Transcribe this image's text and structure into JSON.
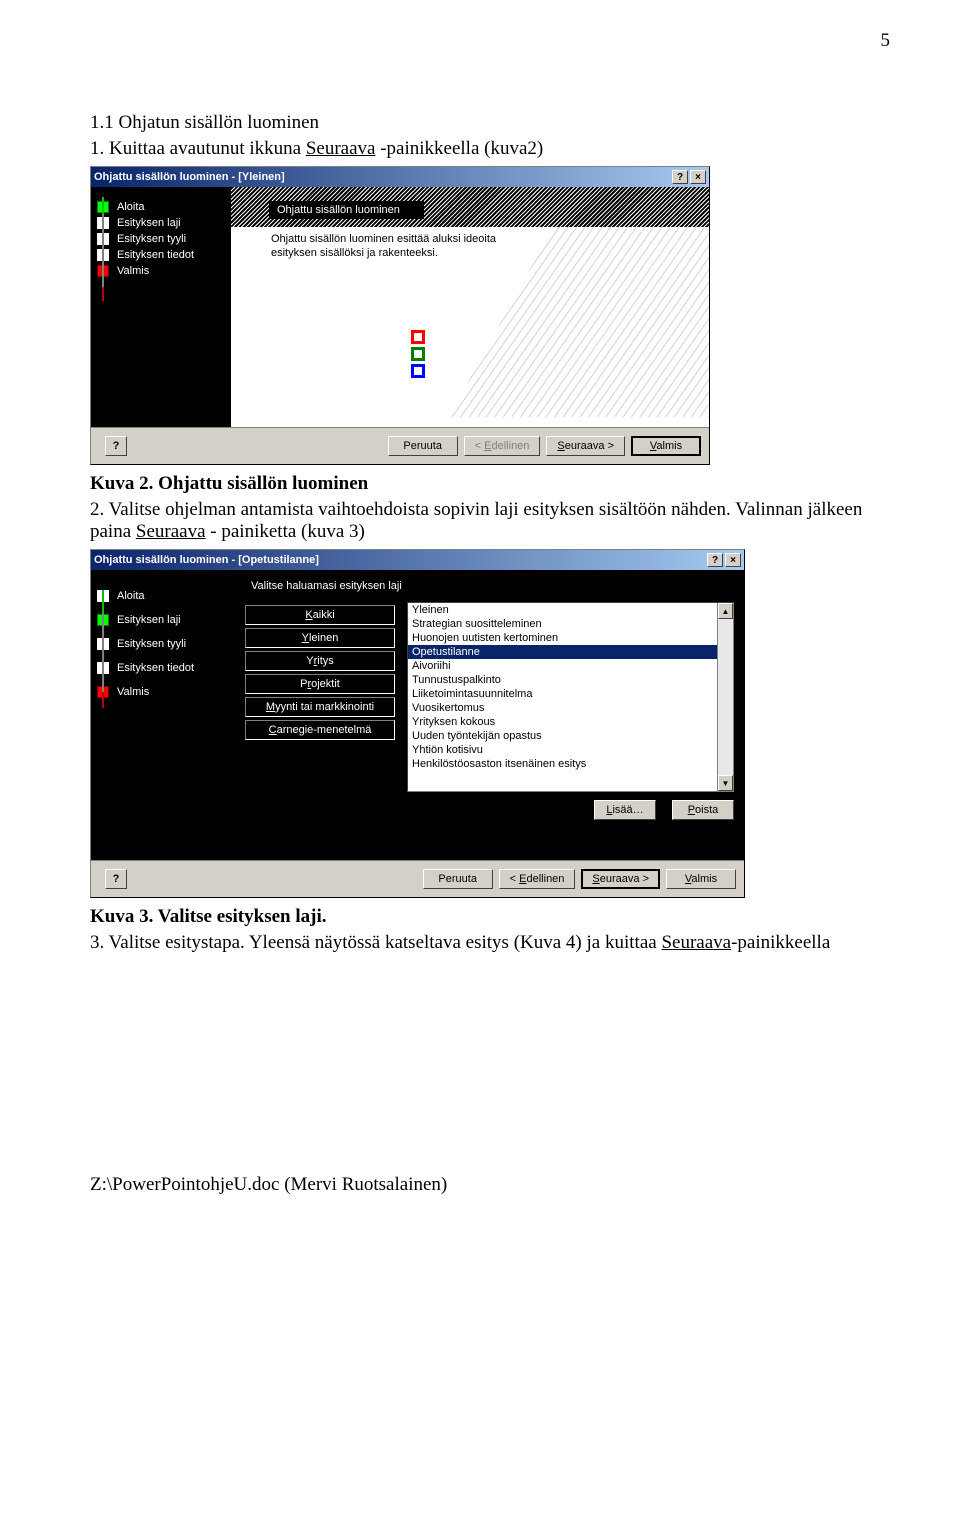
{
  "page_number": "5",
  "heading": "1.1 Ohjatun sisällön luominen",
  "para1_pre": "1. Kuittaa avautunut ikkuna ",
  "para1_link": "Seuraava",
  "para1_post": " -painikkeella (kuva2)",
  "caption1": "Kuva 2. Ohjattu sisällön luominen",
  "para2_pre": "2. Valitse ohjelman antamista vaihtoehdoista sopivin laji esityksen sisältöön nähden. Valinnan jälkeen paina ",
  "para2_link": "Seuraava",
  "para2_post": " - painiketta (kuva 3)",
  "caption2": "Kuva 3. Valitse esityksen laji.",
  "para3_pre": "3. Valitse esitystapa. Yleensä näytössä katseltava esitys (Kuva 4) ja kuittaa ",
  "para3_link": "Seuraava",
  "para3_post": "-painikkeella",
  "footer": "Z:\\PowerPointohjeU.doc (Mervi Ruotsalainen)",
  "dialog1": {
    "title": "Ohjattu sisällön luominen - [Yleinen]",
    "help_btn": "?",
    "close_btn": "×",
    "steps": [
      "Aloita",
      "Esityksen laji",
      "Esityksen tyyli",
      "Esityksen tiedot",
      "Valmis"
    ],
    "box_title": "Ohjattu sisällön luominen",
    "description": "Ohjattu sisällön luominen esittää aluksi ideoita esityksen sisällöksi ja rakenteeksi.",
    "buttons": {
      "help": "?",
      "cancel": "Peruuta",
      "back_pre": "< ",
      "back_u": "E",
      "back_post": "dellinen",
      "next_u": "S",
      "next_post": "euraava >",
      "finish_u": "V",
      "finish_post": "almis"
    }
  },
  "dialog2": {
    "title": "Ohjattu sisällön luominen - [Opetustilanne]",
    "help_btn": "?",
    "close_btn": "×",
    "steps": [
      "Aloita",
      "Esityksen laji",
      "Esityksen tyyli",
      "Esityksen tiedot",
      "Valmis"
    ],
    "prompt": "Valitse haluamasi esityksen laji",
    "categories": [
      {
        "u": "K",
        "post": "aikki"
      },
      {
        "u": "Y",
        "post": "leinen"
      },
      {
        "pre": "Y",
        "u": "r",
        "post": "itys"
      },
      {
        "pre": "P",
        "u": "r",
        "post": "ojektit"
      },
      {
        "u": "M",
        "post": "yynti tai markkinointi"
      },
      {
        "u": "C",
        "post": "arnegie-menetelmä"
      }
    ],
    "list": [
      "Yleinen",
      "Strategian suositteleminen",
      "Huonojen uutisten kertominen",
      "Opetustilanne",
      "Aivoriihi",
      "Tunnustuspalkinto",
      "Liiketoimintasuunnitelma",
      "Vuosikertomus",
      "Yrityksen kokous",
      "Uuden työntekijän opastus",
      "Yhtiön kotisivu",
      "Henkilöstöosaston itsenäinen esitys"
    ],
    "selected_index": 3,
    "add_u": "L",
    "add_post": "isää…",
    "del_u": "P",
    "del_post": "oista",
    "buttons": {
      "help": "?",
      "cancel": "Peruuta",
      "back_pre": "< ",
      "back_u": "E",
      "back_post": "dellinen",
      "next_u": "S",
      "next_post": "euraava >",
      "finish_u": "V",
      "finish_post": "almis"
    }
  }
}
